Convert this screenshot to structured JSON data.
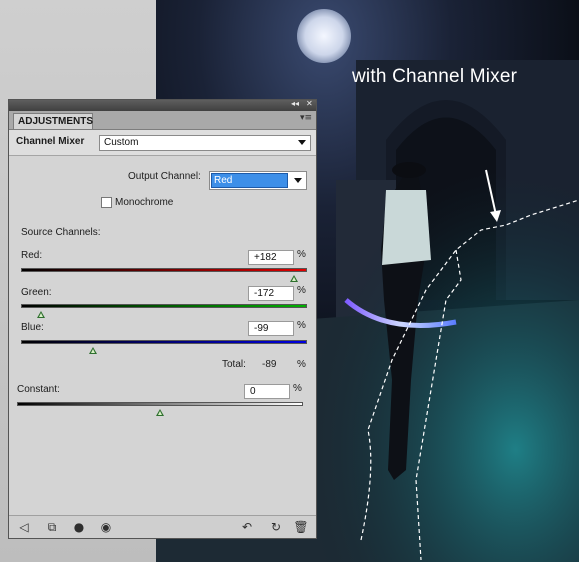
{
  "caption": "with Channel Mixer",
  "panel": {
    "tab_label": "ADJUSTMENTS",
    "collapse_glyph": "◂◂",
    "close_glyph": "✕",
    "menu_glyph": "▾≡",
    "title": "Channel Mixer",
    "preset_value": "Custom",
    "output_channel_label": "Output Channel:",
    "output_channel_value": "Red",
    "monochrome_label": "Monochrome",
    "monochrome_checked": false,
    "source_channels_label": "Source Channels:",
    "channels": [
      {
        "label": "Red:",
        "value": "+182",
        "unit": "%",
        "percent": 182,
        "color": "#d40000"
      },
      {
        "label": "Green:",
        "value": "-172",
        "unit": "%",
        "percent": -172,
        "color": "#16a016"
      },
      {
        "label": "Blue:",
        "value": "-99",
        "unit": "%",
        "percent": -99,
        "color": "#1a1ad0"
      }
    ],
    "total_label": "Total:",
    "total_value": "-89",
    "total_unit": "%",
    "constant_label": "Constant:",
    "constant_value": "0",
    "constant_unit": "%",
    "constant_percent": 0,
    "footer_icons": [
      "back-arrow-icon",
      "clip-to-layer-icon",
      "mask-icon",
      "visibility-eye-icon",
      "previous-state-icon",
      "reset-icon",
      "trash-icon"
    ]
  }
}
